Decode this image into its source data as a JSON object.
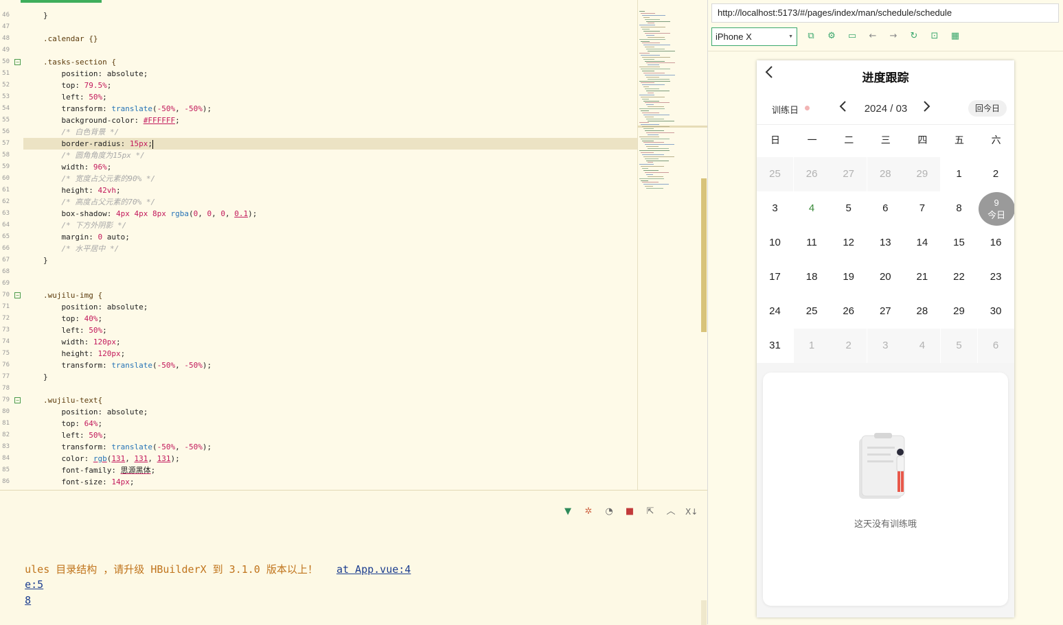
{
  "editor": {
    "lines": [
      {
        "n": "46",
        "fold": false,
        "cur": false,
        "tokens": [
          [
            "}",
            "tk-prop"
          ]
        ]
      },
      {
        "n": "47",
        "fold": false,
        "cur": false,
        "tokens": []
      },
      {
        "n": "48",
        "fold": false,
        "cur": false,
        "tokens": [
          [
            ".calendar {}",
            "tk-sel"
          ]
        ]
      },
      {
        "n": "49",
        "fold": false,
        "cur": false,
        "tokens": []
      },
      {
        "n": "50",
        "fold": true,
        "cur": false,
        "tokens": [
          [
            ".tasks-section {",
            "tk-sel"
          ]
        ]
      },
      {
        "n": "51",
        "fold": false,
        "cur": false,
        "tokens": [
          [
            "    position: absolute;",
            "tk-prop"
          ]
        ]
      },
      {
        "n": "52",
        "fold": false,
        "cur": false,
        "tokens": [
          [
            "    top: ",
            "tk-prop"
          ],
          [
            "79.5%",
            "tk-num"
          ],
          [
            ";",
            "tk-prop"
          ]
        ]
      },
      {
        "n": "53",
        "fold": false,
        "cur": false,
        "tokens": [
          [
            "    left: ",
            "tk-prop"
          ],
          [
            "50%",
            "tk-num"
          ],
          [
            ";",
            "tk-prop"
          ]
        ]
      },
      {
        "n": "54",
        "fold": false,
        "cur": false,
        "tokens": [
          [
            "    transform: ",
            "tk-prop"
          ],
          [
            "translate",
            "tk-fn"
          ],
          [
            "(",
            "tk-prop"
          ],
          [
            "-50%",
            "tk-num"
          ],
          [
            ", ",
            "tk-prop"
          ],
          [
            "-50%",
            "tk-num"
          ],
          [
            ");",
            "tk-prop"
          ]
        ]
      },
      {
        "n": "55",
        "fold": false,
        "cur": false,
        "tokens": [
          [
            "    background-color: ",
            "tk-prop"
          ],
          [
            "#FFFFFF",
            "tk-num tk-und"
          ],
          [
            ";",
            "tk-prop"
          ]
        ]
      },
      {
        "n": "56",
        "fold": false,
        "cur": false,
        "tokens": [
          [
            "    /* 白色背景 */",
            "tk-com"
          ]
        ]
      },
      {
        "n": "57",
        "fold": false,
        "cur": true,
        "tokens": [
          [
            "    border-radius: ",
            "tk-prop"
          ],
          [
            "15px",
            "tk-num"
          ],
          [
            ";",
            "tk-prop"
          ]
        ]
      },
      {
        "n": "58",
        "fold": false,
        "cur": false,
        "tokens": [
          [
            "    /* 圆角角度为15px */",
            "tk-com"
          ]
        ]
      },
      {
        "n": "59",
        "fold": false,
        "cur": false,
        "tokens": [
          [
            "    width: ",
            "tk-prop"
          ],
          [
            "96%",
            "tk-num"
          ],
          [
            ";",
            "tk-prop"
          ]
        ]
      },
      {
        "n": "60",
        "fold": false,
        "cur": false,
        "tokens": [
          [
            "    /* 宽度占父元素的90% */",
            "tk-com"
          ]
        ]
      },
      {
        "n": "61",
        "fold": false,
        "cur": false,
        "tokens": [
          [
            "    height: ",
            "tk-prop"
          ],
          [
            "42vh",
            "tk-num"
          ],
          [
            ";",
            "tk-prop"
          ]
        ]
      },
      {
        "n": "62",
        "fold": false,
        "cur": false,
        "tokens": [
          [
            "    /* 高度占父元素的70% */",
            "tk-com"
          ]
        ]
      },
      {
        "n": "63",
        "fold": false,
        "cur": false,
        "tokens": [
          [
            "    box-shadow: ",
            "tk-prop"
          ],
          [
            "4px 4px 8px ",
            "tk-num"
          ],
          [
            "rgba",
            "tk-fn"
          ],
          [
            "(",
            "tk-prop"
          ],
          [
            "0",
            "tk-num"
          ],
          [
            ", ",
            "tk-prop"
          ],
          [
            "0",
            "tk-num"
          ],
          [
            ", ",
            "tk-prop"
          ],
          [
            "0",
            "tk-num"
          ],
          [
            ", ",
            "tk-prop"
          ],
          [
            "0.1",
            "tk-num tk-und"
          ],
          [
            ");",
            "tk-prop"
          ]
        ]
      },
      {
        "n": "64",
        "fold": false,
        "cur": false,
        "tokens": [
          [
            "    /* 下方外阴影 */",
            "tk-com"
          ]
        ]
      },
      {
        "n": "65",
        "fold": false,
        "cur": false,
        "tokens": [
          [
            "    margin: ",
            "tk-prop"
          ],
          [
            "0",
            "tk-num"
          ],
          [
            " auto;",
            "tk-prop"
          ]
        ]
      },
      {
        "n": "66",
        "fold": false,
        "cur": false,
        "tokens": [
          [
            "    /* 水平居中 */",
            "tk-com"
          ]
        ]
      },
      {
        "n": "67",
        "fold": false,
        "cur": false,
        "tokens": [
          [
            "}",
            "tk-prop"
          ]
        ]
      },
      {
        "n": "68",
        "fold": false,
        "cur": false,
        "tokens": []
      },
      {
        "n": "69",
        "fold": false,
        "cur": false,
        "tokens": []
      },
      {
        "n": "70",
        "fold": true,
        "cur": false,
        "tokens": [
          [
            ".wujilu-img {",
            "tk-sel"
          ]
        ]
      },
      {
        "n": "71",
        "fold": false,
        "cur": false,
        "tokens": [
          [
            "    position: absolute;",
            "tk-prop"
          ]
        ]
      },
      {
        "n": "72",
        "fold": false,
        "cur": false,
        "tokens": [
          [
            "    top: ",
            "tk-prop"
          ],
          [
            "40%",
            "tk-num"
          ],
          [
            ";",
            "tk-prop"
          ]
        ]
      },
      {
        "n": "73",
        "fold": false,
        "cur": false,
        "tokens": [
          [
            "    left: ",
            "tk-prop"
          ],
          [
            "50%",
            "tk-num"
          ],
          [
            ";",
            "tk-prop"
          ]
        ]
      },
      {
        "n": "74",
        "fold": false,
        "cur": false,
        "tokens": [
          [
            "    width: ",
            "tk-prop"
          ],
          [
            "120px",
            "tk-num"
          ],
          [
            ";",
            "tk-prop"
          ]
        ]
      },
      {
        "n": "75",
        "fold": false,
        "cur": false,
        "tokens": [
          [
            "    height: ",
            "tk-prop"
          ],
          [
            "120px",
            "tk-num"
          ],
          [
            ";",
            "tk-prop"
          ]
        ]
      },
      {
        "n": "76",
        "fold": false,
        "cur": false,
        "tokens": [
          [
            "    transform: ",
            "tk-prop"
          ],
          [
            "translate",
            "tk-fn"
          ],
          [
            "(",
            "tk-prop"
          ],
          [
            "-50%",
            "tk-num"
          ],
          [
            ", ",
            "tk-prop"
          ],
          [
            "-50%",
            "tk-num"
          ],
          [
            ");",
            "tk-prop"
          ]
        ]
      },
      {
        "n": "77",
        "fold": false,
        "cur": false,
        "tokens": [
          [
            "}",
            "tk-prop"
          ]
        ]
      },
      {
        "n": "78",
        "fold": false,
        "cur": false,
        "tokens": []
      },
      {
        "n": "79",
        "fold": true,
        "cur": false,
        "tokens": [
          [
            ".wujilu-text{",
            "tk-sel"
          ]
        ]
      },
      {
        "n": "80",
        "fold": false,
        "cur": false,
        "tokens": [
          [
            "    position: absolute;",
            "tk-prop"
          ]
        ]
      },
      {
        "n": "81",
        "fold": false,
        "cur": false,
        "tokens": [
          [
            "    top: ",
            "tk-prop"
          ],
          [
            "64%",
            "tk-num"
          ],
          [
            ";",
            "tk-prop"
          ]
        ]
      },
      {
        "n": "82",
        "fold": false,
        "cur": false,
        "tokens": [
          [
            "    left: ",
            "tk-prop"
          ],
          [
            "50%",
            "tk-num"
          ],
          [
            ";",
            "tk-prop"
          ]
        ]
      },
      {
        "n": "83",
        "fold": false,
        "cur": false,
        "tokens": [
          [
            "    transform: ",
            "tk-prop"
          ],
          [
            "translate",
            "tk-fn"
          ],
          [
            "(",
            "tk-prop"
          ],
          [
            "-50%",
            "tk-num"
          ],
          [
            ", ",
            "tk-prop"
          ],
          [
            "-50%",
            "tk-num"
          ],
          [
            ");",
            "tk-prop"
          ]
        ]
      },
      {
        "n": "84",
        "fold": false,
        "cur": false,
        "tokens": [
          [
            "    color: ",
            "tk-prop"
          ],
          [
            "rgb",
            "tk-fn tk-und"
          ],
          [
            "(",
            "tk-prop"
          ],
          [
            "131",
            "tk-num tk-und"
          ],
          [
            ", ",
            "tk-prop"
          ],
          [
            "131",
            "tk-num tk-und"
          ],
          [
            ", ",
            "tk-prop"
          ],
          [
            "131",
            "tk-num tk-und"
          ],
          [
            ");",
            "tk-prop"
          ]
        ]
      },
      {
        "n": "85",
        "fold": false,
        "cur": false,
        "tokens": [
          [
            "    font-family: ",
            "tk-prop"
          ],
          [
            "思源黑体",
            "tk-prop tk-und"
          ],
          [
            ";",
            "tk-prop"
          ]
        ]
      },
      {
        "n": "86",
        "fold": false,
        "cur": false,
        "tokens": [
          [
            "    font-size: ",
            "tk-prop"
          ],
          [
            "14px",
            "tk-num"
          ],
          [
            ";",
            "tk-prop"
          ]
        ]
      }
    ]
  },
  "console": {
    "line1_warn": "ules 目录结构 ，请升级 HBuilderX 到 3.1.0 版本以上！",
    "line1_link": "at App.vue:4",
    "line2_link": "e:5",
    "line3_link": "8",
    "tools": [
      "vue-icon",
      "bug-icon",
      "run-icon",
      "stop-icon",
      "export-icon",
      "collapse-icon",
      "clear-icon"
    ]
  },
  "browser": {
    "url": "http://localhost:5173/#/pages/index/man/schedule/schedule",
    "device": "iPhone X",
    "tools": [
      "open-external-icon",
      "settings-icon",
      "console-icon",
      "back-icon",
      "forward-icon",
      "refresh-icon",
      "lock-icon",
      "grid-icon"
    ]
  },
  "app": {
    "title": "进度跟踪",
    "train_label": "训练日",
    "month": "2024 / 03",
    "today_button": "回今日",
    "weekdays": [
      "日",
      "一",
      "二",
      "三",
      "四",
      "五",
      "六"
    ],
    "today_label": "今日",
    "empty_text": "这天没有训练哦",
    "accent_color": "#3a8a3a",
    "today_color": "#9a9a9a",
    "days": [
      {
        "d": "25",
        "t": "other"
      },
      {
        "d": "26",
        "t": "other"
      },
      {
        "d": "27",
        "t": "other"
      },
      {
        "d": "28",
        "t": "other"
      },
      {
        "d": "29",
        "t": "other"
      },
      {
        "d": "1",
        "t": "cur"
      },
      {
        "d": "2",
        "t": "cur"
      },
      {
        "d": "3",
        "t": "cur"
      },
      {
        "d": "4",
        "t": "green"
      },
      {
        "d": "5",
        "t": "cur"
      },
      {
        "d": "6",
        "t": "cur"
      },
      {
        "d": "7",
        "t": "cur"
      },
      {
        "d": "8",
        "t": "cur"
      },
      {
        "d": "9",
        "t": "today"
      },
      {
        "d": "10",
        "t": "cur"
      },
      {
        "d": "11",
        "t": "cur"
      },
      {
        "d": "12",
        "t": "cur"
      },
      {
        "d": "13",
        "t": "cur"
      },
      {
        "d": "14",
        "t": "cur"
      },
      {
        "d": "15",
        "t": "cur"
      },
      {
        "d": "16",
        "t": "cur"
      },
      {
        "d": "17",
        "t": "cur"
      },
      {
        "d": "18",
        "t": "cur"
      },
      {
        "d": "19",
        "t": "cur"
      },
      {
        "d": "20",
        "t": "cur"
      },
      {
        "d": "21",
        "t": "cur"
      },
      {
        "d": "22",
        "t": "cur"
      },
      {
        "d": "23",
        "t": "cur"
      },
      {
        "d": "24",
        "t": "cur"
      },
      {
        "d": "25",
        "t": "cur"
      },
      {
        "d": "26",
        "t": "cur"
      },
      {
        "d": "27",
        "t": "cur"
      },
      {
        "d": "28",
        "t": "cur"
      },
      {
        "d": "29",
        "t": "cur"
      },
      {
        "d": "30",
        "t": "cur"
      },
      {
        "d": "31",
        "t": "cur"
      },
      {
        "d": "1",
        "t": "other"
      },
      {
        "d": "2",
        "t": "other"
      },
      {
        "d": "3",
        "t": "other"
      },
      {
        "d": "4",
        "t": "other"
      },
      {
        "d": "5",
        "t": "other"
      },
      {
        "d": "6",
        "t": "other"
      }
    ]
  }
}
